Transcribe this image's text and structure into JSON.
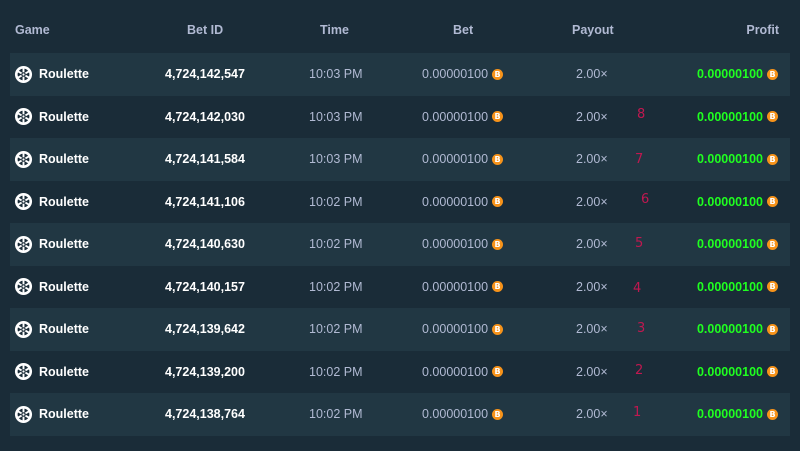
{
  "header": {
    "game": "Game",
    "bet_id": "Bet ID",
    "time": "Time",
    "bet": "Bet",
    "payout": "Payout",
    "profit": "Profit"
  },
  "colors": {
    "background": "#1a2c38",
    "row_alt": "#213743",
    "profit_green": "#1fff20",
    "coin_orange": "#f7931a",
    "annotation": "#c01850"
  },
  "rows": [
    {
      "game": "Roulette",
      "bet_id": "4,724,142,547",
      "time": "10:03 PM",
      "bet": "0.00000100",
      "payout": "2.00×",
      "profit": "0.00000100",
      "annotation": ""
    },
    {
      "game": "Roulette",
      "bet_id": "4,724,142,030",
      "time": "10:03 PM",
      "bet": "0.00000100",
      "payout": "2.00×",
      "profit": "0.00000100",
      "annotation": "8"
    },
    {
      "game": "Roulette",
      "bet_id": "4,724,141,584",
      "time": "10:03 PM",
      "bet": "0.00000100",
      "payout": "2.00×",
      "profit": "0.00000100",
      "annotation": "7"
    },
    {
      "game": "Roulette",
      "bet_id": "4,724,141,106",
      "time": "10:02 PM",
      "bet": "0.00000100",
      "payout": "2.00×",
      "profit": "0.00000100",
      "annotation": "6"
    },
    {
      "game": "Roulette",
      "bet_id": "4,724,140,630",
      "time": "10:02 PM",
      "bet": "0.00000100",
      "payout": "2.00×",
      "profit": "0.00000100",
      "annotation": "5"
    },
    {
      "game": "Roulette",
      "bet_id": "4,724,140,157",
      "time": "10:02 PM",
      "bet": "0.00000100",
      "payout": "2.00×",
      "profit": "0.00000100",
      "annotation": "4"
    },
    {
      "game": "Roulette",
      "bet_id": "4,724,139,642",
      "time": "10:02 PM",
      "bet": "0.00000100",
      "payout": "2.00×",
      "profit": "0.00000100",
      "annotation": "3"
    },
    {
      "game": "Roulette",
      "bet_id": "4,724,139,200",
      "time": "10:02 PM",
      "bet": "0.00000100",
      "payout": "2.00×",
      "profit": "0.00000100",
      "annotation": "2"
    },
    {
      "game": "Roulette",
      "bet_id": "4,724,138,764",
      "time": "10:02 PM",
      "bet": "0.00000100",
      "payout": "2.00×",
      "profit": "0.00000100",
      "annotation": "1"
    }
  ]
}
